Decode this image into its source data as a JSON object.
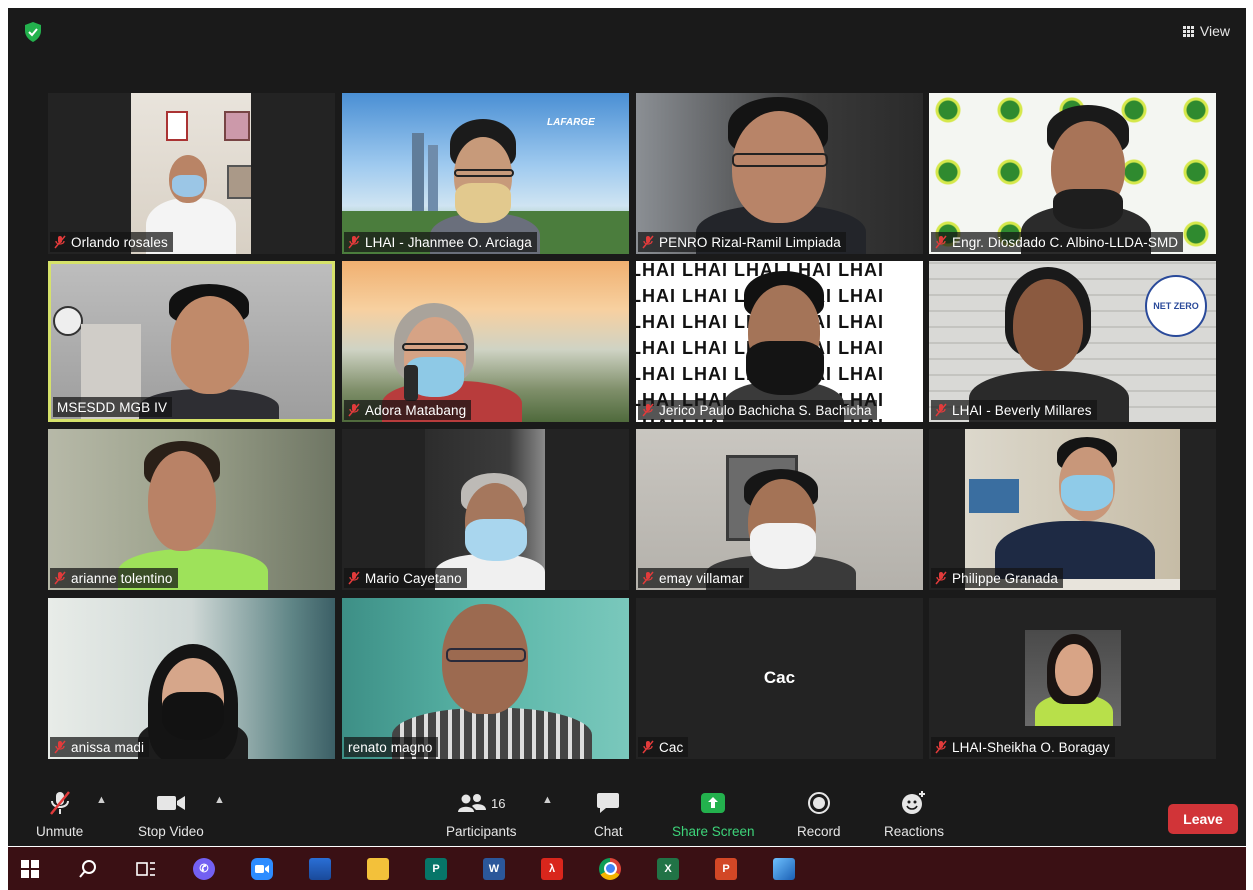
{
  "top_bar": {
    "view_label": "View"
  },
  "participants": [
    {
      "name": "Orlando rosales",
      "muted": true
    },
    {
      "name": "LHAI - Jhanmee O. Arciaga",
      "muted": true
    },
    {
      "name": "PENRO Rizal-Ramil Limpiada",
      "muted": true
    },
    {
      "name": "Engr. Diosdado C. Albino-LLDA-SMD",
      "muted": true
    },
    {
      "name": "MSESDD MGB IV",
      "muted": false,
      "active_speaker": true
    },
    {
      "name": "Adora Matabang",
      "muted": true
    },
    {
      "name": "Jerico Paulo Bachicha S. Bachicha",
      "muted": true
    },
    {
      "name": "LHAI - Beverly Millares",
      "muted": true
    },
    {
      "name": "arianne tolentino",
      "muted": true
    },
    {
      "name": "Mario Cayetano",
      "muted": true
    },
    {
      "name": "emay villamar",
      "muted": true
    },
    {
      "name": "Philippe Granada",
      "muted": true
    },
    {
      "name": "anissa madi",
      "muted": true
    },
    {
      "name": "renato magno",
      "muted": false
    },
    {
      "name": "Cac",
      "muted": true,
      "video_off": true,
      "center_label": "Cac"
    },
    {
      "name": "LHAI-Sheikha O. Boragay",
      "muted": true
    }
  ],
  "tile_text": {
    "lafarge_logo": "LAFARGE",
    "lhai_word": "LHAI",
    "seal_text": "NET ZERO"
  },
  "toolbar": {
    "unmute_label": "Unmute",
    "stop_video_label": "Stop Video",
    "participants_label": "Participants",
    "participants_count": "16",
    "chat_label": "Chat",
    "share_screen_label": "Share Screen",
    "record_label": "Record",
    "reactions_label": "Reactions",
    "leave_label": "Leave"
  },
  "colors": {
    "active_speaker_border": "#d6e26a",
    "share_screen_green": "#3dd47a",
    "leave_red": "#d13438",
    "muted_mic_red": "#e23b3b",
    "taskbar": "#3a1014"
  },
  "taskbar": {
    "icons": [
      "windows-start-icon",
      "search-icon",
      "task-view-icon",
      "viber-icon",
      "zoom-icon",
      "photos-icon",
      "file-explorer-icon",
      "publisher-icon",
      "word-icon",
      "acrobat-icon",
      "chrome-icon",
      "excel-icon",
      "powerpoint-icon",
      "photos-app-icon"
    ]
  }
}
